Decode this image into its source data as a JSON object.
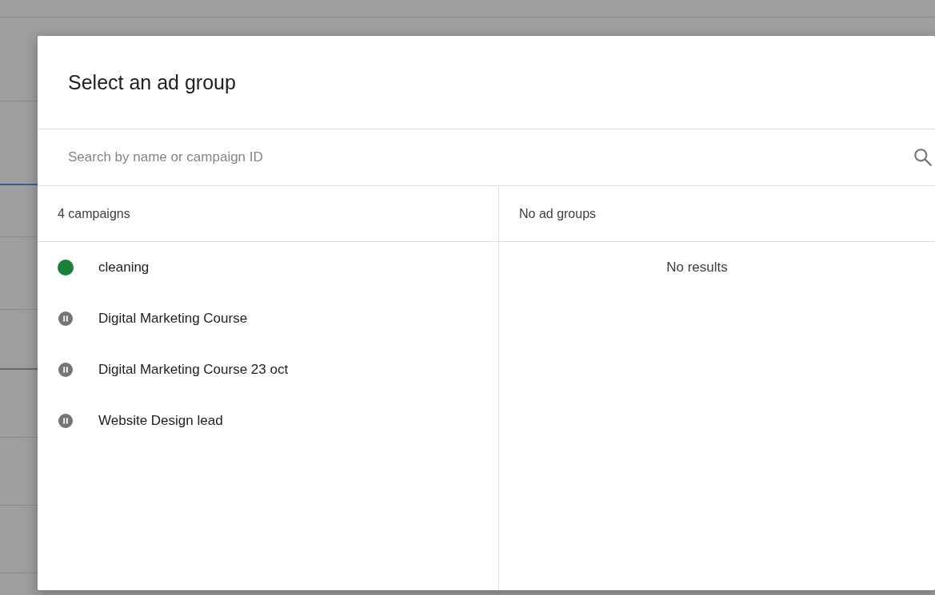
{
  "dialog": {
    "title": "Select an ad group",
    "search": {
      "placeholder": "Search by name or campaign ID"
    },
    "campaigns": {
      "header": "4 campaigns",
      "items": [
        {
          "name": "cleaning",
          "kind": "active"
        },
        {
          "name": "Digital Marketing Course",
          "kind": "paused"
        },
        {
          "name": "Digital Marketing Course 23 oct",
          "kind": "paused"
        },
        {
          "name": "Website Design lead",
          "kind": "paused"
        }
      ]
    },
    "ad_groups": {
      "header": "No ad groups",
      "empty_message": "No results"
    }
  }
}
